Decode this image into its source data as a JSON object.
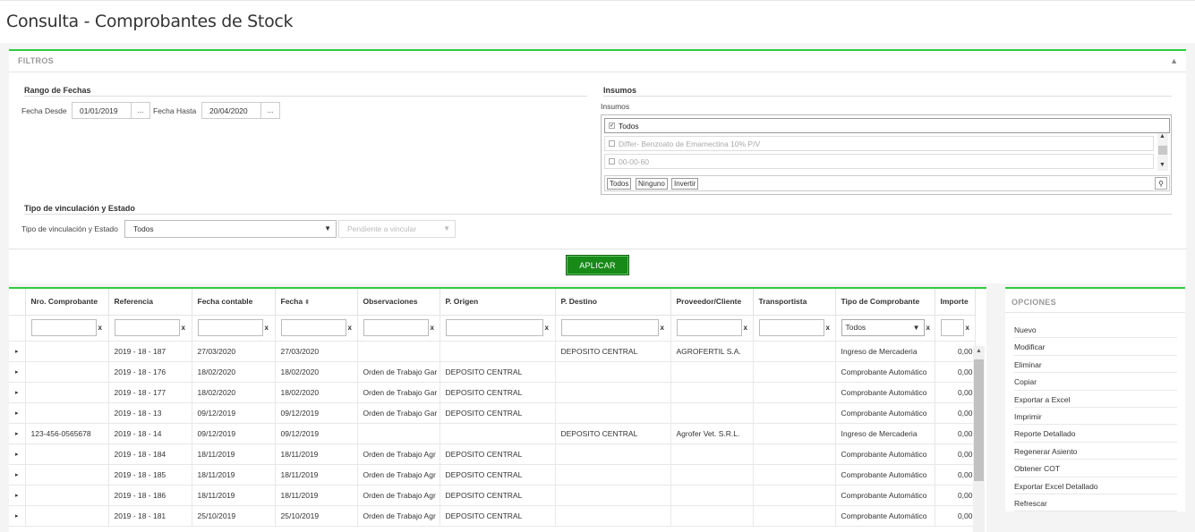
{
  "page": {
    "title": "Consulta - Comprobantes de Stock"
  },
  "filters": {
    "title": "FILTROS",
    "collapse_icon": "chevron-up-icon",
    "date_section": "Rango de Fechas",
    "date_from_label": "Fecha Desde",
    "date_from_value": "01/01/2019",
    "date_to_label": "Fecha Hasta",
    "date_to_value": "20/04/2020",
    "picker_label": "...",
    "insumos_section": "Insumos",
    "insumos_label": "Insumos",
    "insumos_items": [
      {
        "label": "Todos",
        "checked": true
      },
      {
        "label": "Differ- Benzoato de Emamectina 10% P/V",
        "checked": false
      },
      {
        "label": "00-00-60",
        "checked": false
      }
    ],
    "insumos_buttons": [
      "Todos",
      "Ninguno",
      "Invertir"
    ],
    "vinc_section": "Tipo de vinculación y Estado",
    "vinc_label": "Tipo de vinculación y Estado",
    "vinc_value": "Todos",
    "estado_value": "Pendiente a vincular",
    "apply_label": "APLICAR"
  },
  "grid": {
    "columns": [
      "Nro. Comprobante",
      "Referencia",
      "Fecha contable",
      "Fecha",
      "Observaciones",
      "P. Origen",
      "P. Destino",
      "Proveedor/Cliente",
      "Transportista",
      "Tipo de Comprobante",
      "Importe"
    ],
    "filter_clear": "x",
    "tipo_filter_value": "Todos",
    "rows": [
      [
        "",
        "2019 - 18 - 187",
        "27/03/2020",
        "27/03/2020",
        "",
        "",
        "DEPOSITO CENTRAL",
        "AGROFERTIL S.A.",
        "",
        "Ingreso de Mercaderia",
        "0,00"
      ],
      [
        "",
        "2019 - 18 - 176",
        "18/02/2020",
        "18/02/2020",
        "Orden de Trabajo Gar",
        "DEPOSITO CENTRAL",
        "",
        "",
        "",
        "Comprobante Automático",
        "0,00"
      ],
      [
        "",
        "2019 - 18 - 177",
        "18/02/2020",
        "18/02/2020",
        "Orden de Trabajo Gar",
        "DEPOSITO CENTRAL",
        "",
        "",
        "",
        "Comprobante Automático",
        "0,00"
      ],
      [
        "",
        "2019 - 18 - 13",
        "09/12/2019",
        "09/12/2019",
        "Orden de Trabajo Gar",
        "DEPOSITO CENTRAL",
        "",
        "",
        "",
        "Comprobante Automático",
        "0,00"
      ],
      [
        "123-456-0565678",
        "2019 - 18 - 14",
        "09/12/2019",
        "09/12/2019",
        "",
        "",
        "DEPOSITO CENTRAL",
        "Agrofer Vet. S.R.L.",
        "",
        "Ingreso de Mercaderia",
        "0,00"
      ],
      [
        "",
        "2019 - 18 - 184",
        "18/11/2019",
        "18/11/2019",
        "Orden de Trabajo Agr",
        "DEPOSITO CENTRAL",
        "",
        "",
        "",
        "Comprobante Automático",
        "0,00"
      ],
      [
        "",
        "2019 - 18 - 185",
        "18/11/2019",
        "18/11/2019",
        "Orden de Trabajo Agr",
        "DEPOSITO CENTRAL",
        "",
        "",
        "",
        "Comprobante Automático",
        "0,00"
      ],
      [
        "",
        "2019 - 18 - 186",
        "18/11/2019",
        "18/11/2019",
        "Orden de Trabajo Agr",
        "DEPOSITO CENTRAL",
        "",
        "",
        "",
        "Comprobante Automático",
        "0,00"
      ],
      [
        "",
        "2019 - 18 - 181",
        "25/10/2019",
        "25/10/2019",
        "Orden de Trabajo Agr",
        "DEPOSITO CENTRAL",
        "",
        "",
        "",
        "Comprobante Automático",
        "0,00"
      ]
    ]
  },
  "options": {
    "title": "OPCIONES",
    "items": [
      "Nuevo",
      "Modificar",
      "Eliminar",
      "Copiar",
      "Exportar a Excel",
      "Imprimir",
      "Reporte Detallado",
      "Regenerar Asiento",
      "Obtener COT",
      "Exportar Excel Detallado",
      "Refrescar"
    ]
  },
  "colors": {
    "accent_green": "#2ecc40",
    "apply_button": "#178a18"
  }
}
